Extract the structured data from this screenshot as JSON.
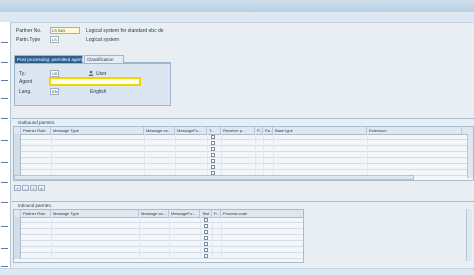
{
  "header": {
    "partner_no_label": "Partner No.",
    "partner_no_value": "LS  ING",
    "partner_no_desc": "Logical system for standard ebc de",
    "partn_type_label": "Partn.Type",
    "partn_type_value": "LS",
    "partn_type_desc": "Logical system"
  },
  "tabs": [
    {
      "label": "Post processing: permitted agent",
      "active": true
    },
    {
      "label": "Classification",
      "active": false
    }
  ],
  "agent_panel": {
    "ty_label": "Ty.:",
    "ty_value": "US",
    "ty_desc": "User",
    "agent_label": "Agent",
    "agent_value": "",
    "lang_label": "Lang.",
    "lang_value": "EN",
    "lang_desc": "English"
  },
  "outbound": {
    "title": "Outbound parmtrs.",
    "columns": [
      "Partner Role",
      "Message Type",
      "Message va...",
      "MessageFu...",
      "T...",
      "Receiver p...",
      "P...",
      "Pa...",
      "Base type",
      "Extension",
      ""
    ],
    "row_count": 8
  },
  "inbound": {
    "title": "Inbound parmtrs.",
    "columns": [
      "Partner Role",
      "Message Type",
      "Message va...",
      "MessageFu...",
      "Test",
      "P...",
      "Process code"
    ],
    "row_count": 8
  },
  "table_buttons": [
    "+",
    "-",
    "i",
    "⌕"
  ],
  "colors": {
    "agent_field_border": "#f2d400",
    "active_tab_bg": "#2b5f8e",
    "panel_bg": "#dbe6f0"
  }
}
